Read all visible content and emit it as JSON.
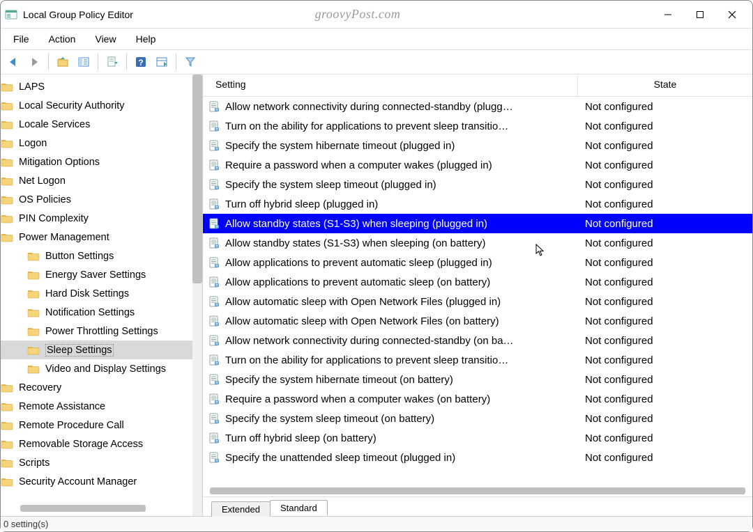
{
  "window": {
    "title": "Local Group Policy Editor",
    "watermark": "groovyPost.com"
  },
  "menu": [
    "File",
    "Action",
    "View",
    "Help"
  ],
  "columns": {
    "setting": "Setting",
    "state": "State"
  },
  "tree": [
    {
      "label": "LAPS",
      "level": 1
    },
    {
      "label": "Local Security Authority",
      "level": 1
    },
    {
      "label": "Locale Services",
      "level": 1
    },
    {
      "label": "Logon",
      "level": 1
    },
    {
      "label": "Mitigation Options",
      "level": 1
    },
    {
      "label": "Net Logon",
      "level": 1
    },
    {
      "label": "OS Policies",
      "level": 1
    },
    {
      "label": "PIN Complexity",
      "level": 1
    },
    {
      "label": "Power Management",
      "level": 1
    },
    {
      "label": "Button Settings",
      "level": 2
    },
    {
      "label": "Energy Saver Settings",
      "level": 2
    },
    {
      "label": "Hard Disk Settings",
      "level": 2
    },
    {
      "label": "Notification Settings",
      "level": 2
    },
    {
      "label": "Power Throttling Settings",
      "level": 2
    },
    {
      "label": "Sleep Settings",
      "level": 2,
      "selected": true
    },
    {
      "label": "Video and Display Settings",
      "level": 2
    },
    {
      "label": "Recovery",
      "level": 1
    },
    {
      "label": "Remote Assistance",
      "level": 1
    },
    {
      "label": "Remote Procedure Call",
      "level": 1
    },
    {
      "label": "Removable Storage Access",
      "level": 1
    },
    {
      "label": "Scripts",
      "level": 1
    },
    {
      "label": "Security Account Manager",
      "level": 1
    }
  ],
  "settings": [
    {
      "name": "Allow network connectivity during connected-standby (plugg…",
      "state": "Not configured"
    },
    {
      "name": "Turn on the ability for applications to prevent sleep transitio…",
      "state": "Not configured"
    },
    {
      "name": "Specify the system hibernate timeout (plugged in)",
      "state": "Not configured"
    },
    {
      "name": "Require a password when a computer wakes (plugged in)",
      "state": "Not configured"
    },
    {
      "name": "Specify the system sleep timeout (plugged in)",
      "state": "Not configured"
    },
    {
      "name": "Turn off hybrid sleep (plugged in)",
      "state": "Not configured"
    },
    {
      "name": "Allow standby states (S1-S3) when sleeping (plugged in)",
      "state": "Not configured",
      "selected": true
    },
    {
      "name": "Allow standby states (S1-S3) when sleeping (on battery)",
      "state": "Not configured"
    },
    {
      "name": "Allow applications to prevent automatic sleep (plugged in)",
      "state": "Not configured"
    },
    {
      "name": "Allow applications to prevent automatic sleep (on battery)",
      "state": "Not configured"
    },
    {
      "name": "Allow automatic sleep with Open Network Files (plugged in)",
      "state": "Not configured"
    },
    {
      "name": "Allow automatic sleep with Open Network Files (on battery)",
      "state": "Not configured"
    },
    {
      "name": "Allow network connectivity during connected-standby (on ba…",
      "state": "Not configured"
    },
    {
      "name": "Turn on the ability for applications to prevent sleep transitio…",
      "state": "Not configured"
    },
    {
      "name": "Specify the system hibernate timeout (on battery)",
      "state": "Not configured"
    },
    {
      "name": "Require a password when a computer wakes (on battery)",
      "state": "Not configured"
    },
    {
      "name": "Specify the system sleep timeout (on battery)",
      "state": "Not configured"
    },
    {
      "name": "Turn off hybrid sleep (on battery)",
      "state": "Not configured"
    },
    {
      "name": "Specify the unattended sleep timeout (plugged in)",
      "state": "Not configured"
    }
  ],
  "tabs": {
    "extended": "Extended",
    "standard": "Standard",
    "active": "standard"
  },
  "status": "0 setting(s)"
}
